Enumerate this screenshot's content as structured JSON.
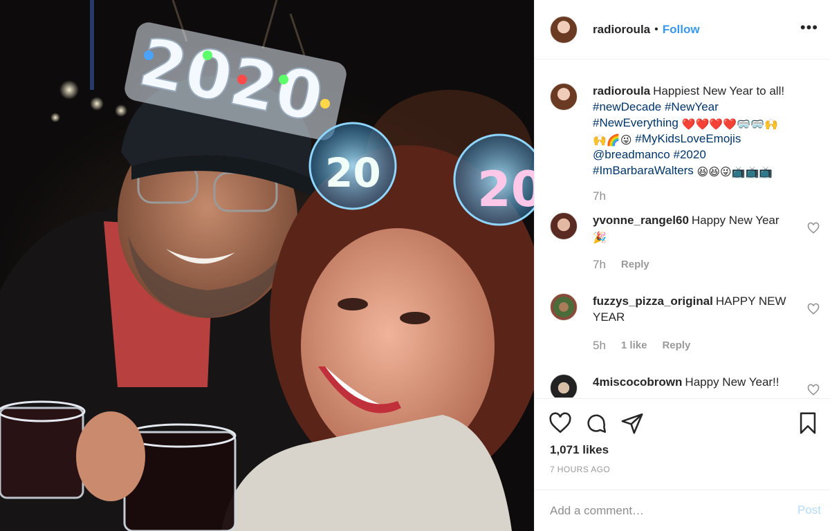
{
  "post": {
    "username": "radioroula",
    "follow_label": "Follow",
    "separator": "•",
    "more_label": "•••"
  },
  "photo": {
    "glasses_text": "2020",
    "ear_left_text": "20",
    "ear_right_text": "20"
  },
  "caption": {
    "username": "radioroula",
    "text": "Happiest New Year to all!",
    "tags_line1": "#newDecade #NewYear",
    "tags_line2": "#NewEverything",
    "emojis_line2": "❤️❤️❤️❤️🥽🥽🙌",
    "emojis_line3a": "🙌🌈😜",
    "tags_line3": "#MyKidsLoveEmojis",
    "mention": "@breadmanco",
    "tag_2020": "#2020",
    "tags_line5": "#ImBarbaraWalters",
    "emojis_line5": "😆😆😜📺📺📺",
    "time": "7h"
  },
  "comments": [
    {
      "username": "yvonne_rangel60",
      "text": "Happy New Year",
      "emoji": "🎉",
      "time": "7h",
      "reply": "Reply"
    },
    {
      "username": "fuzzys_pizza_original",
      "text": "HAPPY NEW YEAR",
      "time": "5h",
      "likes": "1 like",
      "reply": "Reply"
    },
    {
      "username": "4miscocobrown",
      "text": "Happy New Year!!"
    }
  ],
  "engagement": {
    "likes": "1,071 likes",
    "ago": "7 HOURS AGO"
  },
  "composer": {
    "placeholder": "Add a comment…",
    "post_label": "Post"
  },
  "colors": {
    "link": "#3897f0",
    "hashtag": "#003569",
    "heart_red": "#ed4956"
  },
  "icons": [
    "heart-icon",
    "comment-icon",
    "share-icon",
    "bookmark-icon",
    "more-icon"
  ]
}
